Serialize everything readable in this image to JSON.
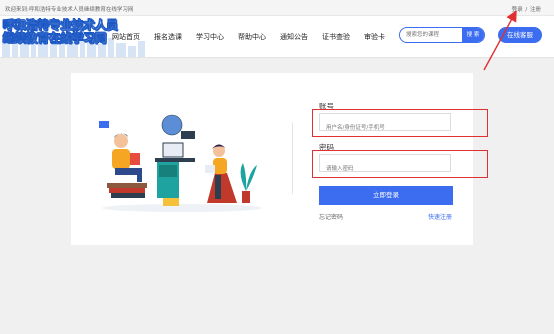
{
  "topbar": {
    "welcome": "欢迎来到:呼和浩特专业技术人员继续教育在线学习网",
    "login": "登录",
    "separator": "/",
    "register": "注册"
  },
  "logo": {
    "line1": "呼和浩特专业技术人员",
    "line2": "继续教育在线学习网"
  },
  "nav": {
    "items": [
      "网站首页",
      "报名选课",
      "学习中心",
      "帮助中心",
      "通知公告",
      "证书查验",
      "审验卡"
    ]
  },
  "search": {
    "placeholder": "搜索您的课程",
    "button": "搜 索"
  },
  "consult_button": "在线客服",
  "login_form": {
    "account_label": "账号",
    "account_placeholder": "用户名/身份证号/手机号",
    "password_label": "密码",
    "password_placeholder": "请输入密码",
    "submit": "立即登录",
    "forgot": "忘记密码",
    "register": "快速注册"
  },
  "colors": {
    "accent": "#3c6cf0",
    "annotation": "#e03030"
  }
}
